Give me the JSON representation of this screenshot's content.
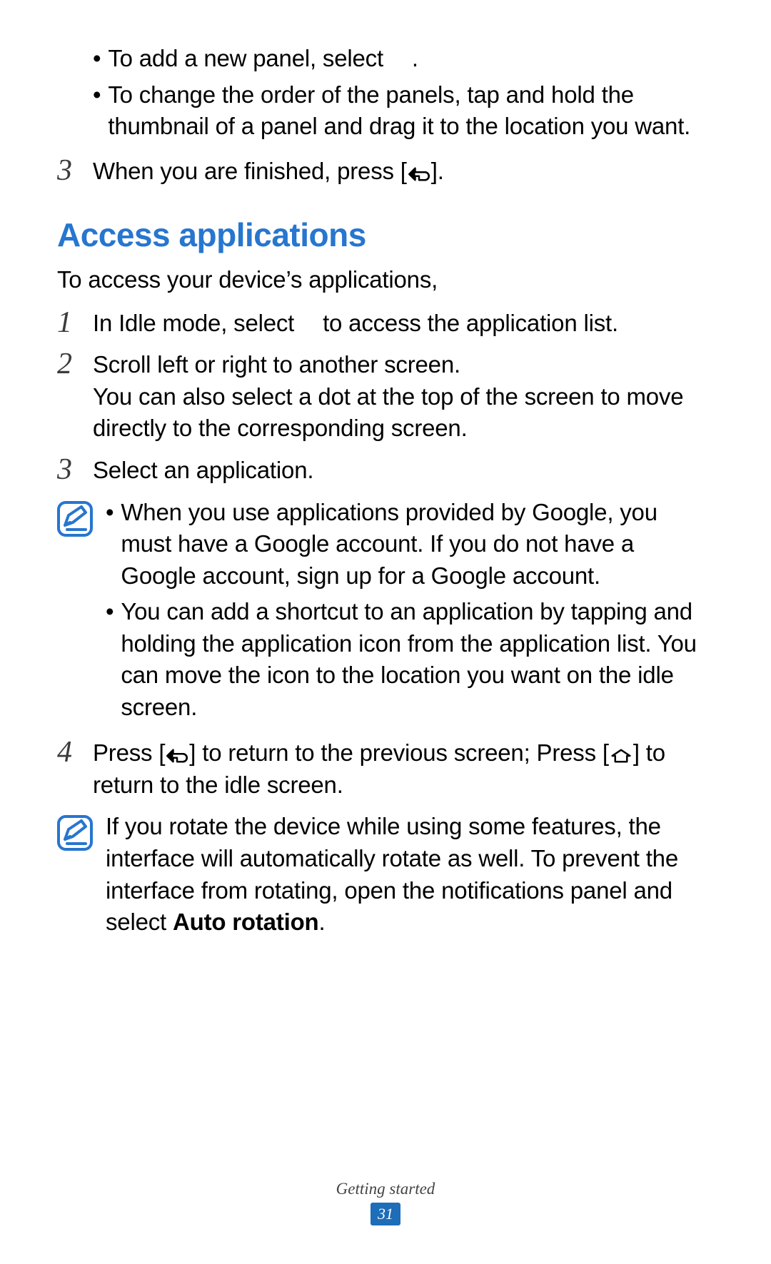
{
  "top": {
    "bullet1_pre": "To add a new panel, select ",
    "bullet1_post": ".",
    "bullet2": "To change the order of the panels, tap and hold the thumbnail of a panel and drag it to the location you want.",
    "step3_pre": "When you are finished, press [",
    "step3_post": "]."
  },
  "section": {
    "heading": "Access applications",
    "intro": "To access your device’s applications,",
    "step1_pre": "In Idle mode, select ",
    "step1_post": " to access the application list.",
    "step2_line1": "Scroll left or right to another screen.",
    "step2_line2": "You can also select a dot at the top of the screen to move directly to the corresponding screen.",
    "step3": "Select an application.",
    "note1_bullet1": "When you use applications provided by Google, you must have a Google account. If you do not have a Google account, sign up for a Google account.",
    "note1_bullet2": "You can add a shortcut to an application by tapping and holding the application icon from the application list. You can move the icon to the location you want on the idle screen.",
    "step4_pre": "Press [",
    "step4_mid": "] to return to the previous screen; Press [",
    "step4_post": "] to return to the idle screen.",
    "note2_pre": "If you rotate the device while using some features, the interface will automatically rotate as well. To prevent the interface from rotating, open the notifications panel and select ",
    "note2_bold": "Auto rotation",
    "note2_post": "."
  },
  "numbers": {
    "three": "3",
    "one": "1",
    "two": "2",
    "four": "4"
  },
  "footer": {
    "title": "Getting started",
    "page": "31"
  }
}
